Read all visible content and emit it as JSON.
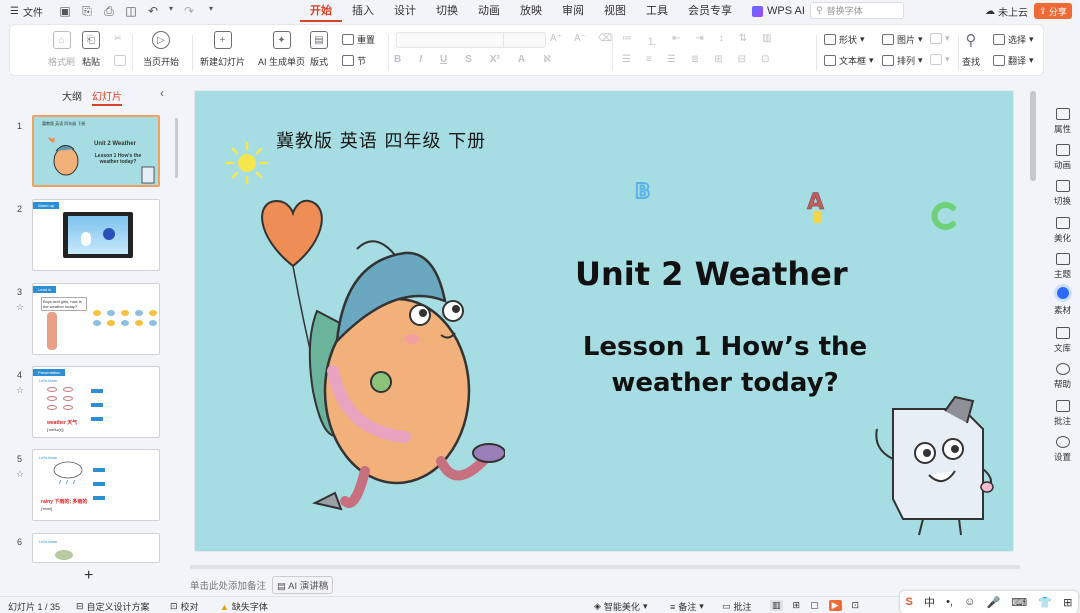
{
  "titlebar": {
    "file_label": "文件",
    "menus": [
      "开始",
      "插入",
      "设计",
      "切换",
      "动画",
      "放映",
      "审阅",
      "视图",
      "工具",
      "会员专享"
    ],
    "active_menu": "开始",
    "wps_ai_label": "WPS AI",
    "search_placeholder": "替换字体",
    "cloud_label": "未上云",
    "share_label": "分享"
  },
  "ribbon": {
    "format_painter": "格式刷",
    "paste": "粘贴",
    "from_start": "当页开始",
    "new_slide": "新建幻灯片",
    "ai_single": "AI 生成单页",
    "layout": "版式",
    "reset": "重置",
    "section": "节",
    "shape": "形状",
    "image": "图片",
    "textbox": "文本框",
    "arrange": "排列",
    "find": "查找",
    "select": "选择",
    "translate": "翻译"
  },
  "left_panel": {
    "tab_outline": "大纲",
    "tab_slides": "幻灯片",
    "active_tab": "幻灯片",
    "thumbnails": [
      {
        "num": "1",
        "title": "Unit 2 Weather",
        "subtitle": "Lesson 1 How's the weather today?",
        "header": "冀教版 英语 四年级 下册"
      },
      {
        "num": "2",
        "tag": "Warm up"
      },
      {
        "num": "3",
        "tag": "Lead in",
        "text": "Boys and girls, how is the weather today?"
      },
      {
        "num": "4",
        "tag": "Presentation",
        "sub": "Let's learn",
        "word": "weather 天气",
        "phon": "['weðə(r)]"
      },
      {
        "num": "5",
        "tag": "Let's learn",
        "word": "rainy 下雨的; 多雨的",
        "phon": "['reɪni]"
      },
      {
        "num": "6",
        "tag": "Let's learn"
      }
    ]
  },
  "slide": {
    "header": "冀教版  英语  四年级  下册",
    "title": "Unit 2 Weather",
    "lesson_line1": "Lesson 1 How’s the",
    "lesson_line2": "weather today?"
  },
  "notes": {
    "placeholder": "单击此处添加备注",
    "ai_btn": "AI 演讲稿"
  },
  "right_sidebar": [
    "属性",
    "动画",
    "切换",
    "美化",
    "主题",
    "素材",
    "文库",
    "帮助",
    "批注",
    "设置"
  ],
  "statusbar": {
    "slide_count": "幻灯片 1 / 35",
    "custom_design": "自定义设计方案",
    "proofread": "校对",
    "missing_font": "缺失字体",
    "smart_beautify": "智能美化",
    "notes": "备注",
    "comments": "批注"
  },
  "ime": {
    "lang": "中"
  }
}
